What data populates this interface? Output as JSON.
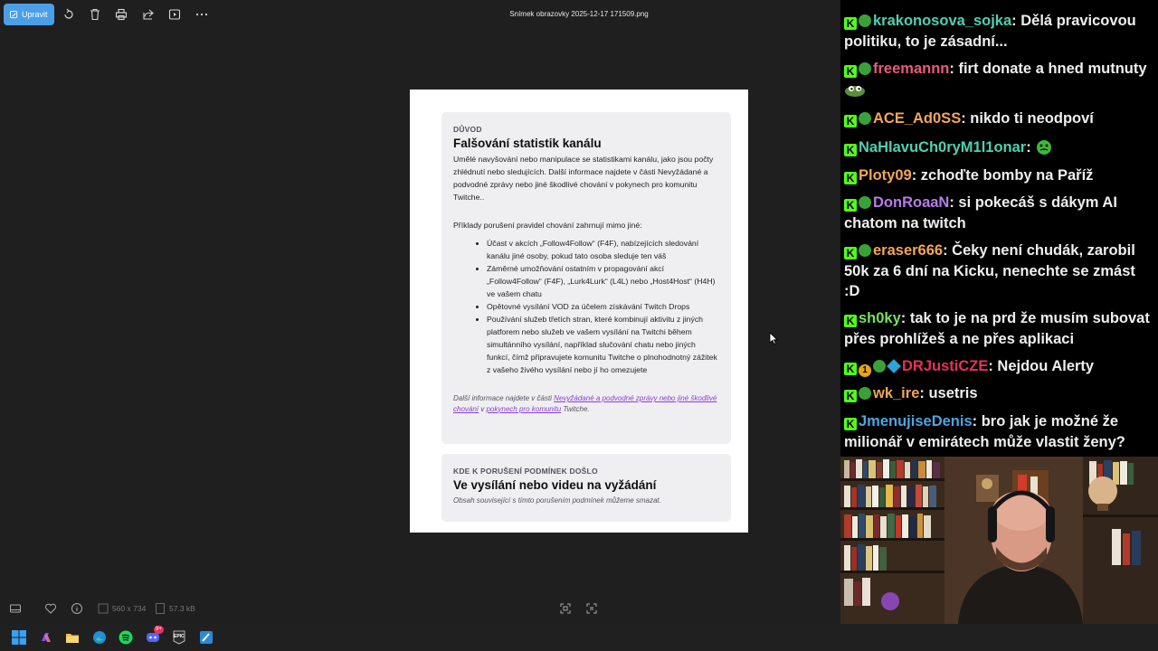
{
  "viewer": {
    "edit_label": "Upravit",
    "file_title": "Snímek obrazovky 2025-12-17 171509.png",
    "dimensions": "560 x 734",
    "file_size": "57.3 kB",
    "toolbar_icons": [
      "rotate-icon",
      "delete-icon",
      "print-icon",
      "share-icon",
      "slideshow-icon",
      "more-icon"
    ],
    "bottom_icons": [
      "filmstrip-icon",
      "favorite-icon",
      "info-icon",
      "fit-icon",
      "actual-size-icon"
    ]
  },
  "document": {
    "card1": {
      "kicker": "DŮVOD",
      "heading": "Falšování statistik kanálu",
      "paragraph": "Umělé navyšování nebo manipulace se statistikami kanálu, jako jsou počty zhlédnutí nebo sledujících. Další informace najdete v části Nevyžádané a podvodné zprávy nebo jiné škodlivé chování v pokynech pro komunitu Twitche..",
      "examples_intro": "Příklady porušení pravidel chování zahrnují mimo jiné:",
      "rules": [
        "Účast v akcích „Follow4Follow“ (F4F), nabízejících sledování kanálu jiné osoby, pokud tato osoba sleduje ten váš",
        "Záměrné umožňování ostatním v propagování akcí „Follow4Follow“ (F4F), „Lurk4Lurk“ (L4L) nebo „Host4Host“ (H4H) ve vašem chatu",
        "Opětovné vysílání VOD za účelem získávání Twitch Drops",
        "Používání služeb třetích stran, které kombinují aktivitu z jiných platforem nebo služeb ve vašem vysílání na Twitchi během simultánního vysílání, například slučování chatu nebo jiných funkcí, čímž připravujete komunitu Twitche o plnohodnotný zážitek z vašeho živého vysílání nebo jí ho omezujete"
      ],
      "note_prefix": "Další informace najdete v části ",
      "note_link1": "Nevyžádané a podvodné zprávy nebo jiné škodlivé chování",
      "note_middle": " v ",
      "note_link2": "pokynech pro komunitu",
      "note_suffix": " Twitche."
    },
    "card2": {
      "kicker": "KDE K PORUŠENÍ PODMÍNEK DOŠLO",
      "heading": "Ve vysílání nebo videu na vyžádání",
      "subtext": "Obsah související s tímto porušením podmínek můžeme smazat."
    }
  },
  "chat": {
    "messages": [
      {
        "user": "krakonosova_sojka",
        "color": "#4fd0b3",
        "text": " Dělá pravicovou politiku, to je zásadní..."
      },
      {
        "user": "freemannn",
        "color": "#e85b7a",
        "text": " firt donate a hned mutnuty"
      },
      {
        "user": "ACE_Ad0SS",
        "color": "#f2a65a",
        "text": " nikdo ti neodpoví"
      },
      {
        "user": "NaHlavuCh0ryM1l1onar",
        "color": "#4fd0b3",
        "text": " "
      },
      {
        "user": "Ploty09",
        "color": "#f2a65a",
        "text": " zchoďte bomby na Paříž"
      },
      {
        "user": "DonRoaaN",
        "color": "#b77ce8",
        "text": " si pokecáš s dákym AI chatom na twitch"
      },
      {
        "user": "eraser666",
        "color": "#f2a65a",
        "text": " Čeky není chudák, zarobil 50k za 6 dní na Kicku, nenechte se zmást :D"
      },
      {
        "user": "sh0ky",
        "color": "#7be05a",
        "text": " tak to je na prd že musím subovat přes prohlížeš a ne přes aplikaci"
      },
      {
        "user": "DRJustiCZE",
        "color": "#e8315a",
        "text": " Nejdou Alerty"
      },
      {
        "user": "wk_ire",
        "color": "#f2a65a",
        "text": " usetris"
      },
      {
        "user": "JmenujiseDenis",
        "color": "#4fa5e0",
        "text": " bro jak je možné že milionář v emirátech může vlastit ženy?"
      }
    ],
    "badge_k_label": "K",
    "badge_count": "1"
  },
  "taskbar": {
    "icons": [
      "windows-start-icon",
      "copilot-icon",
      "file-explorer-icon",
      "edge-icon",
      "spotify-icon",
      "discord-icon",
      "epic-games-icon",
      "paint-icon"
    ],
    "discord_badge": "9+",
    "epic_label": "EPIC"
  }
}
